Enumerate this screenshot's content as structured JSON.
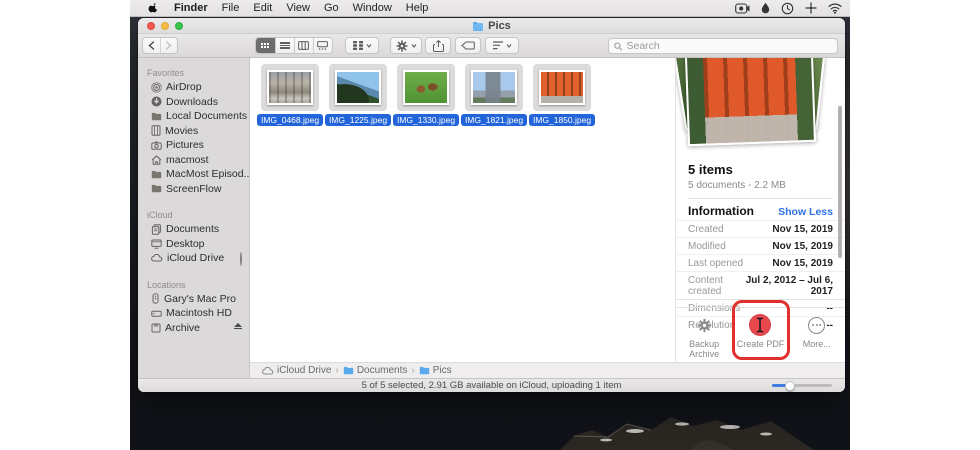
{
  "menu_bar": {
    "app_name": "Finder",
    "items": [
      "File",
      "Edit",
      "View",
      "Go",
      "Window",
      "Help"
    ],
    "status_icons": [
      "screen-recording",
      "droplet",
      "time-machine",
      "location",
      "wifi"
    ]
  },
  "window": {
    "title": "Pics",
    "toolbar": {
      "search_placeholder": "Search",
      "icons": [
        "back",
        "forward",
        "icon-view",
        "list-view",
        "column-view",
        "gallery-view",
        "group",
        "action-menu",
        "share",
        "tag",
        "sort"
      ]
    },
    "sidebar": {
      "sections": [
        {
          "title": "Favorites",
          "items": [
            "AirDrop",
            "Downloads",
            "Local Documents",
            "Movies",
            "Pictures",
            "macmost",
            "MacMost Episod...",
            "ScreenFlow"
          ]
        },
        {
          "title": "iCloud",
          "items": [
            "Documents",
            "Desktop",
            "iCloud Drive"
          ]
        },
        {
          "title": "Locations",
          "items": [
            "Gary's Mac Pro",
            "Macintosh HD",
            "Archive"
          ]
        }
      ]
    },
    "files": [
      "IMG_0468.jpeg",
      "IMG_1225.jpeg",
      "IMG_1330.jpeg",
      "IMG_1821.jpeg",
      "IMG_1850.jpeg"
    ],
    "preview": {
      "items_count": "5 items",
      "summary": "5 documents - 2.2 MB",
      "info_title": "Information",
      "show_toggle": "Show Less",
      "rows": [
        {
          "label": "Created",
          "value": "Nov 15, 2019"
        },
        {
          "label": "Modified",
          "value": "Nov 15, 2019"
        },
        {
          "label": "Last opened",
          "value": "Nov 15, 2019"
        },
        {
          "label": "Content created",
          "value": "Jul 2, 2012 – Jul 6, 2017"
        },
        {
          "label": "Dimensions",
          "value": "--"
        },
        {
          "label": "Resolution",
          "value": "--"
        }
      ],
      "actions": [
        "Backup Archive",
        "Create PDF",
        "More..."
      ]
    },
    "path_bar": [
      "iCloud Drive",
      "Documents",
      "Pics"
    ],
    "status_text": "5 of 5 selected, 2.91 GB available on iCloud, uploading 1 item"
  },
  "colors": {
    "selection_pill_blue": "#2264da",
    "link_blue": "#2e71e5",
    "annotation_red": "#e02f2f",
    "create_pdf_red": "#e8474c",
    "traffic_red": "#f4574e",
    "traffic_yellow": "#f8bd44",
    "traffic_green": "#35c84b"
  }
}
